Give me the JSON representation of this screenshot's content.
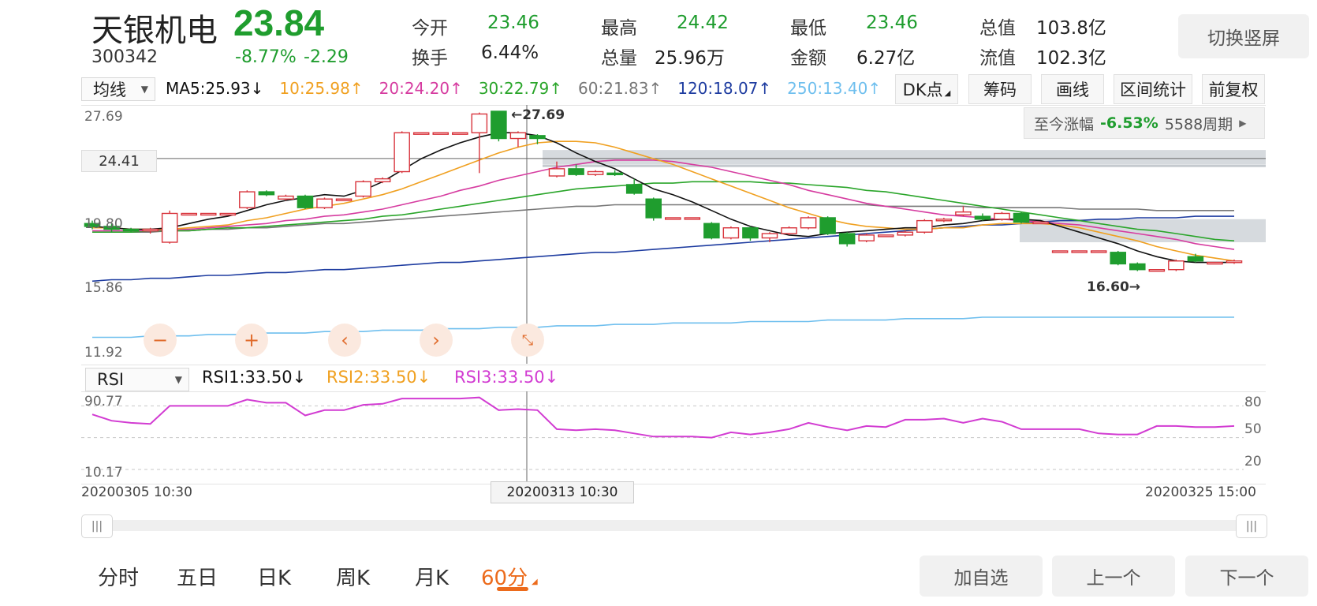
{
  "header": {
    "stock_name": "天银机电",
    "price": "23.84",
    "code": "300342",
    "change_pct": "-8.77%",
    "change_abs": "-2.29",
    "switch_label": "切换竖屏"
  },
  "quote": {
    "open_label": "今开",
    "open_value": "23.46",
    "high_label": "最高",
    "high_value": "24.42",
    "low_label": "最低",
    "low_value": "23.46",
    "mktcap_label": "总值",
    "mktcap_value": "103.8亿",
    "turnover_label": "换手",
    "turnover_value": "6.44%",
    "volume_label": "总量",
    "volume_value": "25.96万",
    "amount_label": "金额",
    "amount_value": "6.27亿",
    "float_label": "流值",
    "float_value": "102.3亿"
  },
  "ma_bar": {
    "indicator": "均线",
    "items": [
      "MA5:25.93↓",
      "10:25.98↑",
      "20:24.20↑",
      "30:22.79↑",
      "60:21.83↑",
      "120:18.07↑",
      "250:13.40↑"
    ],
    "dk_label": "DK点",
    "chip_label": "筹码",
    "draw_label": "画线",
    "range_label": "区间统计",
    "adjust_label": "前复权"
  },
  "colors": {
    "ma5": "#111111",
    "ma10": "#f0a020",
    "ma20": "#d63ca0",
    "ma30": "#2aa52a",
    "ma60": "#777777",
    "ma120": "#1e3ca0",
    "ma250": "#6fbfee",
    "rise": "#d8343c",
    "fall": "#1f9d2e",
    "accent": "#ec6b1c",
    "rsi": "#d23cd2"
  },
  "price_chart": {
    "y_labels": [
      "27.69",
      "24.41",
      "19.80",
      "15.86",
      "11.92"
    ],
    "max_marker": "←27.69",
    "min_marker": "16.60→",
    "since_label": "至今涨幅",
    "since_pct": "-6.53%",
    "since_periods": "5588周期",
    "controls": [
      "minus-icon",
      "plus-icon",
      "chevron-left-icon",
      "chevron-right-icon",
      "collapse-icon"
    ]
  },
  "rsi": {
    "indicator": "RSI",
    "rsi1": "RSI1:33.50↓",
    "rsi2": "RSI2:33.50↓",
    "rsi3": "RSI3:33.50↓",
    "max_label": "90.77",
    "min_label": "10.17",
    "levels": [
      "80",
      "50",
      "20"
    ]
  },
  "time_axis": {
    "start": "20200305 10:30",
    "cross": "20200313 10:30",
    "end": "20200325 15:00"
  },
  "period_tabs": [
    "分时",
    "五日",
    "日K",
    "周K",
    "月K",
    "60分"
  ],
  "bottom_buttons": [
    "加自选",
    "上一个",
    "下一个"
  ],
  "chart_data": {
    "type": "candlestick",
    "candles": [
      {
        "o": 19.9,
        "c": 19.7,
        "h": 20.1,
        "l": 19.5
      },
      {
        "o": 19.7,
        "c": 19.5,
        "h": 19.9,
        "l": 19.3
      },
      {
        "o": 19.5,
        "c": 19.4,
        "h": 19.6,
        "l": 19.3
      },
      {
        "o": 19.4,
        "c": 19.5,
        "h": 19.6,
        "l": 19.2
      },
      {
        "o": 18.6,
        "c": 20.6,
        "h": 20.8,
        "l": 18.5
      },
      {
        "o": 20.6,
        "c": 20.6,
        "h": 20.6,
        "l": 20.6
      },
      {
        "o": 20.6,
        "c": 20.6,
        "h": 20.6,
        "l": 20.6
      },
      {
        "o": 20.6,
        "c": 20.6,
        "h": 20.6,
        "l": 20.6
      },
      {
        "o": 21.0,
        "c": 22.1,
        "h": 22.2,
        "l": 20.9
      },
      {
        "o": 22.1,
        "c": 21.9,
        "h": 22.2,
        "l": 21.8
      },
      {
        "o": 21.6,
        "c": 21.8,
        "h": 21.9,
        "l": 21.5
      },
      {
        "o": 21.8,
        "c": 21.0,
        "h": 21.9,
        "l": 20.9
      },
      {
        "o": 21.0,
        "c": 21.6,
        "h": 21.7,
        "l": 20.9
      },
      {
        "o": 21.6,
        "c": 21.6,
        "h": 21.6,
        "l": 21.6
      },
      {
        "o": 21.8,
        "c": 22.8,
        "h": 22.9,
        "l": 21.7
      },
      {
        "o": 22.8,
        "c": 23.0,
        "h": 23.1,
        "l": 22.7
      },
      {
        "o": 23.5,
        "c": 26.2,
        "h": 26.3,
        "l": 23.4
      },
      {
        "o": 26.2,
        "c": 26.2,
        "h": 26.2,
        "l": 26.2
      },
      {
        "o": 26.2,
        "c": 26.2,
        "h": 26.2,
        "l": 26.2
      },
      {
        "o": 26.2,
        "c": 26.2,
        "h": 26.2,
        "l": 26.2
      },
      {
        "o": 26.2,
        "c": 27.5,
        "h": 27.6,
        "l": 23.4
      },
      {
        "o": 27.69,
        "c": 25.8,
        "h": 27.69,
        "l": 25.6
      },
      {
        "o": 25.8,
        "c": 26.2,
        "h": 26.3,
        "l": 25.2
      },
      {
        "o": 26.0,
        "c": 25.8,
        "h": 26.1,
        "l": 25.4
      },
      {
        "o": 23.2,
        "c": 23.7,
        "h": 24.2,
        "l": 23.1
      },
      {
        "o": 23.7,
        "c": 23.3,
        "h": 24.0,
        "l": 23.2
      },
      {
        "o": 23.3,
        "c": 23.5,
        "h": 23.6,
        "l": 23.2
      },
      {
        "o": 23.4,
        "c": 23.3,
        "h": 23.6,
        "l": 23.2
      },
      {
        "o": 22.6,
        "c": 22.0,
        "h": 23.0,
        "l": 21.9
      },
      {
        "o": 21.6,
        "c": 20.3,
        "h": 21.7,
        "l": 20.1
      },
      {
        "o": 20.3,
        "c": 20.3,
        "h": 20.3,
        "l": 20.3
      },
      {
        "o": 20.3,
        "c": 20.3,
        "h": 20.3,
        "l": 20.3
      },
      {
        "o": 19.9,
        "c": 18.9,
        "h": 20.0,
        "l": 18.8
      },
      {
        "o": 18.9,
        "c": 19.6,
        "h": 19.7,
        "l": 18.8
      },
      {
        "o": 19.6,
        "c": 18.9,
        "h": 19.7,
        "l": 18.7
      },
      {
        "o": 18.9,
        "c": 19.2,
        "h": 19.3,
        "l": 18.6
      },
      {
        "o": 19.2,
        "c": 19.6,
        "h": 19.7,
        "l": 19.1
      },
      {
        "o": 19.6,
        "c": 20.3,
        "h": 20.4,
        "l": 19.5
      },
      {
        "o": 20.3,
        "c": 19.2,
        "h": 20.4,
        "l": 19.1
      },
      {
        "o": 19.2,
        "c": 18.5,
        "h": 19.3,
        "l": 18.3
      },
      {
        "o": 18.7,
        "c": 19.1,
        "h": 19.2,
        "l": 18.6
      },
      {
        "o": 19.1,
        "c": 19.1,
        "h": 19.1,
        "l": 19.1
      },
      {
        "o": 19.1,
        "c": 19.3,
        "h": 19.4,
        "l": 19.0
      },
      {
        "o": 19.3,
        "c": 20.1,
        "h": 20.2,
        "l": 19.2
      },
      {
        "o": 20.1,
        "c": 20.2,
        "h": 20.3,
        "l": 20.0
      },
      {
        "o": 20.5,
        "c": 20.7,
        "h": 21.1,
        "l": 20.4
      },
      {
        "o": 20.4,
        "c": 20.2,
        "h": 20.6,
        "l": 20.1
      },
      {
        "o": 20.2,
        "c": 20.6,
        "h": 20.7,
        "l": 20.1
      },
      {
        "o": 20.6,
        "c": 20.0,
        "h": 20.7,
        "l": 19.9
      },
      {
        "o": 20.0,
        "c": 20.0,
        "h": 20.0,
        "l": 20.0
      },
      {
        "o": 18.0,
        "c": 18.0,
        "h": 18.0,
        "l": 18.0
      },
      {
        "o": 18.0,
        "c": 18.0,
        "h": 18.0,
        "l": 18.0
      },
      {
        "o": 18.0,
        "c": 18.0,
        "h": 18.0,
        "l": 18.0
      },
      {
        "o": 17.9,
        "c": 17.1,
        "h": 18.0,
        "l": 17.0
      },
      {
        "o": 17.1,
        "c": 16.7,
        "h": 17.2,
        "l": 16.6
      },
      {
        "o": 16.7,
        "c": 16.7,
        "h": 16.7,
        "l": 16.6
      },
      {
        "o": 16.7,
        "c": 17.3,
        "h": 17.4,
        "l": 16.6
      },
      {
        "o": 17.6,
        "c": 17.3,
        "h": 17.8,
        "l": 17.2
      },
      {
        "o": 17.2,
        "c": 17.2,
        "h": 17.2,
        "l": 17.1
      },
      {
        "o": 17.2,
        "c": 17.3,
        "h": 17.4,
        "l": 17.1
      }
    ],
    "ma": {
      "ma5": [
        19.7,
        19.6,
        19.5,
        19.5,
        19.6,
        19.9,
        20.2,
        20.4,
        20.8,
        21.2,
        21.5,
        21.7,
        21.9,
        21.8,
        22.2,
        22.8,
        23.6,
        24.4,
        25.0,
        25.5,
        25.9,
        26.2,
        26.2,
        26.0,
        25.5,
        24.8,
        24.2,
        23.7,
        23.0,
        22.3,
        21.9,
        21.4,
        20.8,
        20.2,
        19.7,
        19.4,
        19.1,
        19.0,
        19.2,
        19.3,
        19.4,
        19.5,
        19.6,
        19.6,
        19.8,
        19.9,
        20.1,
        20.2,
        20.2,
        20.1,
        19.7,
        19.3,
        18.9,
        18.5,
        18.0,
        17.6,
        17.3,
        17.2,
        17.2,
        17.2
      ],
      "ma10": [
        19.6,
        19.6,
        19.5,
        19.5,
        19.5,
        19.6,
        19.7,
        19.8,
        20.1,
        20.3,
        20.6,
        20.9,
        21.1,
        21.3,
        21.6,
        21.9,
        22.3,
        22.8,
        23.3,
        23.8,
        24.3,
        24.8,
        25.2,
        25.5,
        25.6,
        25.6,
        25.5,
        25.2,
        24.8,
        24.4,
        24.0,
        23.5,
        23.0,
        22.5,
        22.0,
        21.5,
        21.0,
        20.6,
        20.2,
        19.9,
        19.7,
        19.6,
        19.5,
        19.5,
        19.6,
        19.6,
        19.8,
        19.9,
        19.9,
        19.9,
        19.8,
        19.6,
        19.3,
        19.0,
        18.7,
        18.3,
        18.0,
        17.7,
        17.5,
        17.3
      ],
      "ma20": [
        19.4,
        19.4,
        19.4,
        19.4,
        19.5,
        19.5,
        19.6,
        19.7,
        19.8,
        19.9,
        20.1,
        20.2,
        20.4,
        20.5,
        20.7,
        20.9,
        21.2,
        21.5,
        21.8,
        22.2,
        22.5,
        22.9,
        23.2,
        23.5,
        23.8,
        24.0,
        24.2,
        24.3,
        24.3,
        24.3,
        24.2,
        24.0,
        23.8,
        23.5,
        23.2,
        22.9,
        22.6,
        22.2,
        21.9,
        21.6,
        21.3,
        21.1,
        20.9,
        20.7,
        20.5,
        20.4,
        20.3,
        20.2,
        20.1,
        20.0,
        19.9,
        19.8,
        19.6,
        19.4,
        19.2,
        19.0,
        18.8,
        18.5,
        18.3,
        18.1
      ],
      "ma30": [
        19.3,
        19.3,
        19.3,
        19.4,
        19.4,
        19.4,
        19.5,
        19.6,
        19.6,
        19.7,
        19.8,
        19.9,
        20.0,
        20.1,
        20.2,
        20.4,
        20.5,
        20.7,
        20.9,
        21.1,
        21.3,
        21.5,
        21.7,
        21.9,
        22.1,
        22.3,
        22.4,
        22.5,
        22.6,
        22.7,
        22.7,
        22.8,
        22.8,
        22.8,
        22.8,
        22.7,
        22.7,
        22.6,
        22.5,
        22.4,
        22.2,
        22.1,
        21.9,
        21.7,
        21.5,
        21.3,
        21.1,
        20.9,
        20.7,
        20.5,
        20.3,
        20.1,
        19.9,
        19.7,
        19.5,
        19.4,
        19.2,
        19.0,
        18.8,
        18.7
      ],
      "ma60": [
        19.3,
        19.3,
        19.3,
        19.3,
        19.4,
        19.4,
        19.5,
        19.5,
        19.6,
        19.6,
        19.7,
        19.8,
        19.9,
        19.9,
        20.0,
        20.1,
        20.2,
        20.3,
        20.4,
        20.5,
        20.6,
        20.7,
        20.8,
        20.9,
        21.0,
        21.1,
        21.1,
        21.2,
        21.2,
        21.2,
        21.2,
        21.2,
        21.2,
        21.2,
        21.2,
        21.2,
        21.2,
        21.2,
        21.2,
        21.2,
        21.2,
        21.1,
        21.1,
        21.1,
        21.1,
        21.1,
        21.0,
        21.0,
        21.0,
        21.0,
        21.0,
        20.9,
        20.9,
        20.9,
        20.9,
        20.8,
        20.8,
        20.8,
        20.8,
        20.8
      ],
      "ma120": [
        15.9,
        16.0,
        16.0,
        16.1,
        16.1,
        16.2,
        16.3,
        16.3,
        16.4,
        16.5,
        16.5,
        16.6,
        16.7,
        16.7,
        16.8,
        16.9,
        17.0,
        17.1,
        17.2,
        17.2,
        17.3,
        17.4,
        17.5,
        17.6,
        17.7,
        17.8,
        17.9,
        17.9,
        18.0,
        18.1,
        18.2,
        18.3,
        18.4,
        18.5,
        18.6,
        18.7,
        18.8,
        18.9,
        19.0,
        19.1,
        19.2,
        19.3,
        19.4,
        19.5,
        19.6,
        19.7,
        19.8,
        19.8,
        19.9,
        20.0,
        20.1,
        20.1,
        20.2,
        20.2,
        20.3,
        20.3,
        20.3,
        20.4,
        20.4,
        20.4
      ],
      "ma250": [
        12.0,
        12.0,
        12.0,
        12.1,
        12.1,
        12.1,
        12.2,
        12.2,
        12.2,
        12.3,
        12.3,
        12.3,
        12.4,
        12.4,
        12.4,
        12.5,
        12.5,
        12.5,
        12.6,
        12.6,
        12.6,
        12.7,
        12.7,
        12.7,
        12.8,
        12.8,
        12.8,
        12.9,
        12.9,
        12.9,
        13.0,
        13.0,
        13.0,
        13.0,
        13.1,
        13.1,
        13.1,
        13.1,
        13.2,
        13.2,
        13.2,
        13.2,
        13.3,
        13.3,
        13.3,
        13.3,
        13.4,
        13.4,
        13.4,
        13.4,
        13.4,
        13.4,
        13.4,
        13.4,
        13.4,
        13.4,
        13.4,
        13.4,
        13.4,
        13.4
      ]
    },
    "rsi": [
      72,
      66,
      64,
      63,
      80,
      80,
      80,
      80,
      86,
      83,
      83,
      71,
      76,
      76,
      81,
      82,
      87,
      87,
      87,
      87,
      88,
      76,
      77,
      76,
      58,
      57,
      58,
      57,
      54,
      51,
      51,
      51,
      50,
      55,
      53,
      55,
      58,
      64,
      60,
      57,
      61,
      60,
      67,
      67,
      68,
      64,
      68,
      65,
      58,
      58,
      58,
      58,
      54,
      53,
      53,
      61,
      61,
      60,
      60,
      61
    ],
    "price_ylim": [
      11.92,
      27.69
    ],
    "rsi_ylim": [
      10.17,
      90.77
    ],
    "grid": false
  }
}
